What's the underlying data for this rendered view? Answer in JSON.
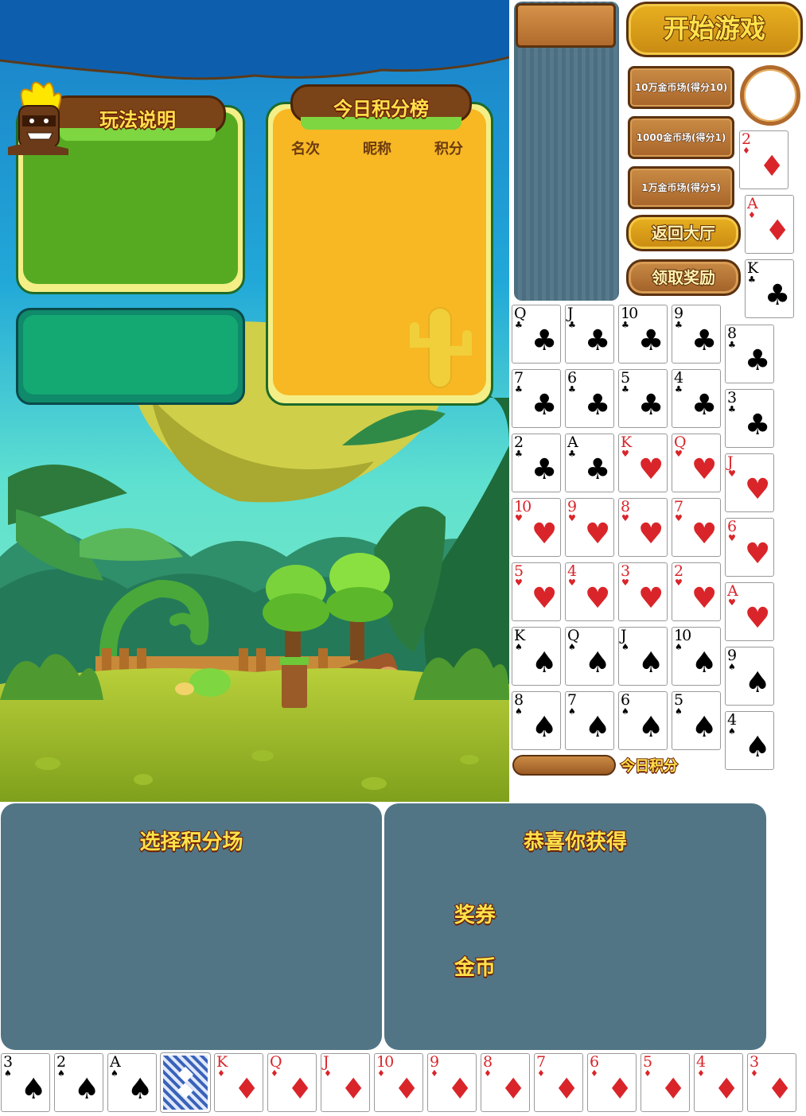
{
  "colors": {
    "panel": "#517585",
    "sky": "#0d5fae",
    "green_panel": "#55aa22",
    "orange_panel": "#f7b824",
    "accent_text": "#ffe24a"
  },
  "rules_panel": {
    "title": "玩法说明"
  },
  "leaderboard": {
    "title": "今日积分榜",
    "columns": [
      "名次",
      "昵称",
      "积分"
    ]
  },
  "buttons": {
    "start_game": "开始游戏",
    "room_100k": "10万金币场(得分10)",
    "room_1000": "1000金币场(得分1)",
    "room_10k": "1万金币场(得分5)",
    "back_lobby": "返回大厅",
    "claim_reward": "领取奖励"
  },
  "today_score_label": "今日积分",
  "select_panel": {
    "title": "选择积分场"
  },
  "reward_panel": {
    "title": "恭喜你获得",
    "items": [
      "奖券",
      "金币"
    ]
  },
  "cards": {
    "right_column": [
      {
        "rank": "2",
        "suit": "♦",
        "color": "red"
      },
      {
        "rank": "A",
        "suit": "♦",
        "color": "red"
      },
      {
        "rank": "K",
        "suit": "♣",
        "color": "black"
      }
    ],
    "grid_rows": [
      [
        {
          "rank": "Q",
          "suit": "♣",
          "color": "black"
        },
        {
          "rank": "J",
          "suit": "♣",
          "color": "black"
        },
        {
          "rank": "10",
          "suit": "♣",
          "color": "black"
        },
        {
          "rank": "9",
          "suit": "♣",
          "color": "black"
        },
        {
          "rank": "8",
          "suit": "♣",
          "color": "black"
        }
      ],
      [
        {
          "rank": "7",
          "suit": "♣",
          "color": "black"
        },
        {
          "rank": "6",
          "suit": "♣",
          "color": "black"
        },
        {
          "rank": "5",
          "suit": "♣",
          "color": "black"
        },
        {
          "rank": "4",
          "suit": "♣",
          "color": "black"
        },
        {
          "rank": "3",
          "suit": "♣",
          "color": "black"
        }
      ],
      [
        {
          "rank": "2",
          "suit": "♣",
          "color": "black"
        },
        {
          "rank": "A",
          "suit": "♣",
          "color": "black"
        },
        {
          "rank": "K",
          "suit": "♥",
          "color": "red"
        },
        {
          "rank": "Q",
          "suit": "♥",
          "color": "red"
        },
        {
          "rank": "J",
          "suit": "♥",
          "color": "red"
        }
      ],
      [
        {
          "rank": "10",
          "suit": "♥",
          "color": "red"
        },
        {
          "rank": "9",
          "suit": "♥",
          "color": "red"
        },
        {
          "rank": "8",
          "suit": "♥",
          "color": "red"
        },
        {
          "rank": "7",
          "suit": "♥",
          "color": "red"
        },
        {
          "rank": "6",
          "suit": "♥",
          "color": "red"
        }
      ],
      [
        {
          "rank": "5",
          "suit": "♥",
          "color": "red"
        },
        {
          "rank": "4",
          "suit": "♥",
          "color": "red"
        },
        {
          "rank": "3",
          "suit": "♥",
          "color": "red"
        },
        {
          "rank": "2",
          "suit": "♥",
          "color": "red"
        },
        {
          "rank": "A",
          "suit": "♥",
          "color": "red"
        }
      ],
      [
        {
          "rank": "K",
          "suit": "♠",
          "color": "black"
        },
        {
          "rank": "Q",
          "suit": "♠",
          "color": "black"
        },
        {
          "rank": "J",
          "suit": "♠",
          "color": "black"
        },
        {
          "rank": "10",
          "suit": "♠",
          "color": "black"
        },
        {
          "rank": "9",
          "suit": "♠",
          "color": "black"
        }
      ],
      [
        {
          "rank": "8",
          "suit": "♠",
          "color": "black"
        },
        {
          "rank": "7",
          "suit": "♠",
          "color": "black"
        },
        {
          "rank": "6",
          "suit": "♠",
          "color": "black"
        },
        {
          "rank": "5",
          "suit": "♠",
          "color": "black"
        },
        {
          "rank": "4",
          "suit": "♠",
          "color": "black"
        }
      ]
    ],
    "bottom_row": [
      {
        "rank": "3",
        "suit": "♠",
        "color": "black"
      },
      {
        "rank": "2",
        "suit": "♠",
        "color": "black"
      },
      {
        "rank": "A",
        "suit": "♠",
        "color": "black"
      },
      {
        "back": true
      },
      {
        "rank": "K",
        "suit": "♦",
        "color": "red"
      },
      {
        "rank": "Q",
        "suit": "♦",
        "color": "red"
      },
      {
        "rank": "J",
        "suit": "♦",
        "color": "red"
      },
      {
        "rank": "10",
        "suit": "♦",
        "color": "red"
      },
      {
        "rank": "9",
        "suit": "♦",
        "color": "red"
      },
      {
        "rank": "8",
        "suit": "♦",
        "color": "red"
      },
      {
        "rank": "7",
        "suit": "♦",
        "color": "red"
      },
      {
        "rank": "6",
        "suit": "♦",
        "color": "red"
      },
      {
        "rank": "5",
        "suit": "♦",
        "color": "red"
      },
      {
        "rank": "4",
        "suit": "♦",
        "color": "red"
      },
      {
        "rank": "3",
        "suit": "♦",
        "color": "red"
      }
    ]
  }
}
